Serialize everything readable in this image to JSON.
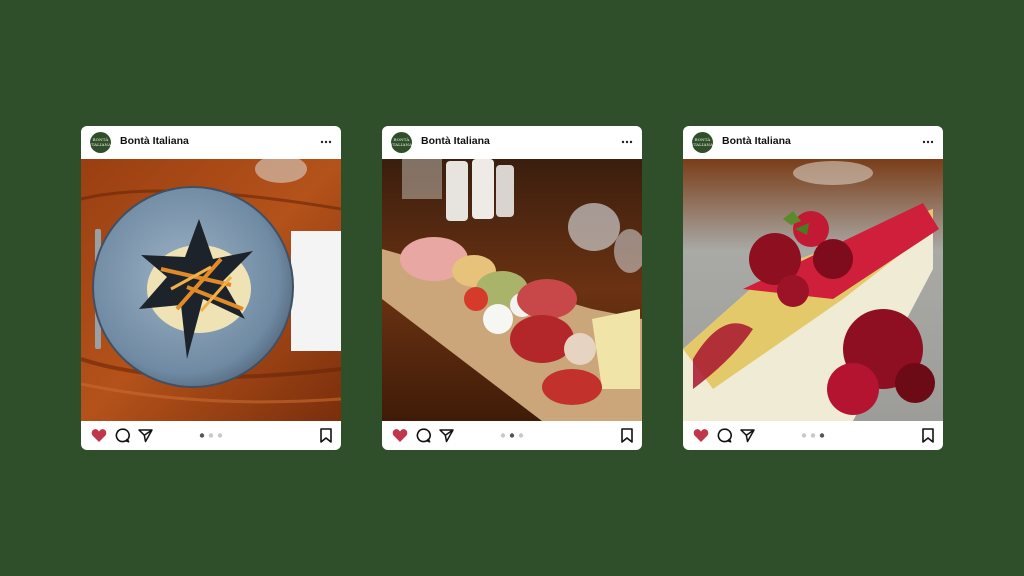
{
  "posts": [
    {
      "account_name": "Bontà Italiana",
      "avatar_text": "BONTÀ ITALIANA",
      "photo_subject": "black ravioli on speckled blue plate",
      "carousel_active": 1,
      "carousel_total": 3
    },
    {
      "account_name": "Bontà Italiana",
      "avatar_text": "BONTÀ ITALIANA",
      "photo_subject": "antipasto board with cured meats and mozzarella",
      "carousel_active": 2,
      "carousel_total": 3
    },
    {
      "account_name": "Bontà Italiana",
      "avatar_text": "BONTÀ ITALIANA",
      "photo_subject": "cheesecake slice with red berry topping",
      "carousel_active": 3,
      "carousel_total": 3
    }
  ],
  "colors": {
    "background": "#2f4f2a",
    "card": "#ffffff",
    "like_active": "#c0364a",
    "dot_active": "#555555",
    "dot_inactive": "#c8c8c8"
  },
  "icons": [
    "more-icon",
    "heart-icon",
    "comment-icon",
    "share-icon",
    "bookmark-icon"
  ]
}
